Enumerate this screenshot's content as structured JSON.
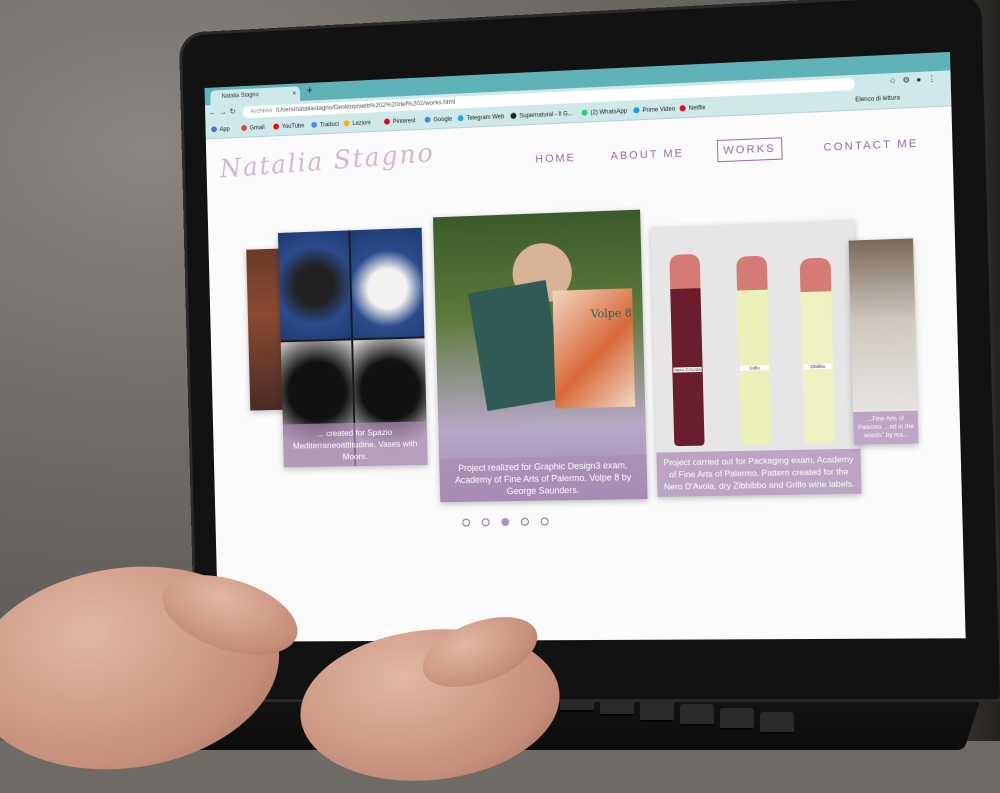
{
  "browser": {
    "tab_title": "Natalia Stagno",
    "tab_close": "×",
    "new_tab": "+",
    "url_prefix": "Archivio",
    "url": "/Users/nataliastagno/Desktop/web%202%20def%202/works.html",
    "bookmarks": [
      {
        "label": "App",
        "color": "#4a6fd8"
      },
      {
        "label": "Gmail",
        "color": "#e54235"
      },
      {
        "label": "YouTube",
        "color": "#ff0000"
      },
      {
        "label": "Traduci",
        "color": "#4a8af4"
      },
      {
        "label": "Lezioni",
        "color": "#f4b400"
      },
      {
        "label": "Pinterest",
        "color": "#e60023"
      },
      {
        "label": "Google",
        "color": "#4285f4"
      },
      {
        "label": "Telegram Web",
        "color": "#2aa3e0"
      },
      {
        "label": "Supernatural - Il G...",
        "color": "#222222"
      },
      {
        "label": "(2) WhatsApp",
        "color": "#25d366"
      },
      {
        "label": "Prime Video",
        "color": "#1a98ff"
      },
      {
        "label": "Netflix",
        "color": "#e50914"
      }
    ],
    "reading_list": "Elenco di lettura"
  },
  "site": {
    "logo": "Natalia Stagno",
    "nav": [
      {
        "label": "HOME",
        "active": false
      },
      {
        "label": "ABOUT ME",
        "active": false
      },
      {
        "label": "WORKS",
        "active": true
      },
      {
        "label": "CONTACT ME",
        "active": false
      }
    ],
    "works": [
      {
        "caption": "... created for Spazio Mediterraneoattitudine. Vases with Moors."
      },
      {
        "caption": "Project realized for Graphic Design3 exam, Academy of Fine Arts of Palermo. Volpe 8 by George Saunders."
      },
      {
        "caption": "Project carried out for Packaging exam, Academy of Fine Arts of Palermo. Pattern created for the Nero D'Avola, dry Zibbibbo and Grillo wine labels."
      },
      {
        "caption": "...Fine Arts of Palermo. ...nd in the woods\" by ma..."
      }
    ],
    "book_title": "Volpe 8",
    "wine_labels": [
      "Nero D'Avola",
      "Grillo",
      "Zibibbo"
    ],
    "carousel_active": 2,
    "carousel_count": 5
  }
}
